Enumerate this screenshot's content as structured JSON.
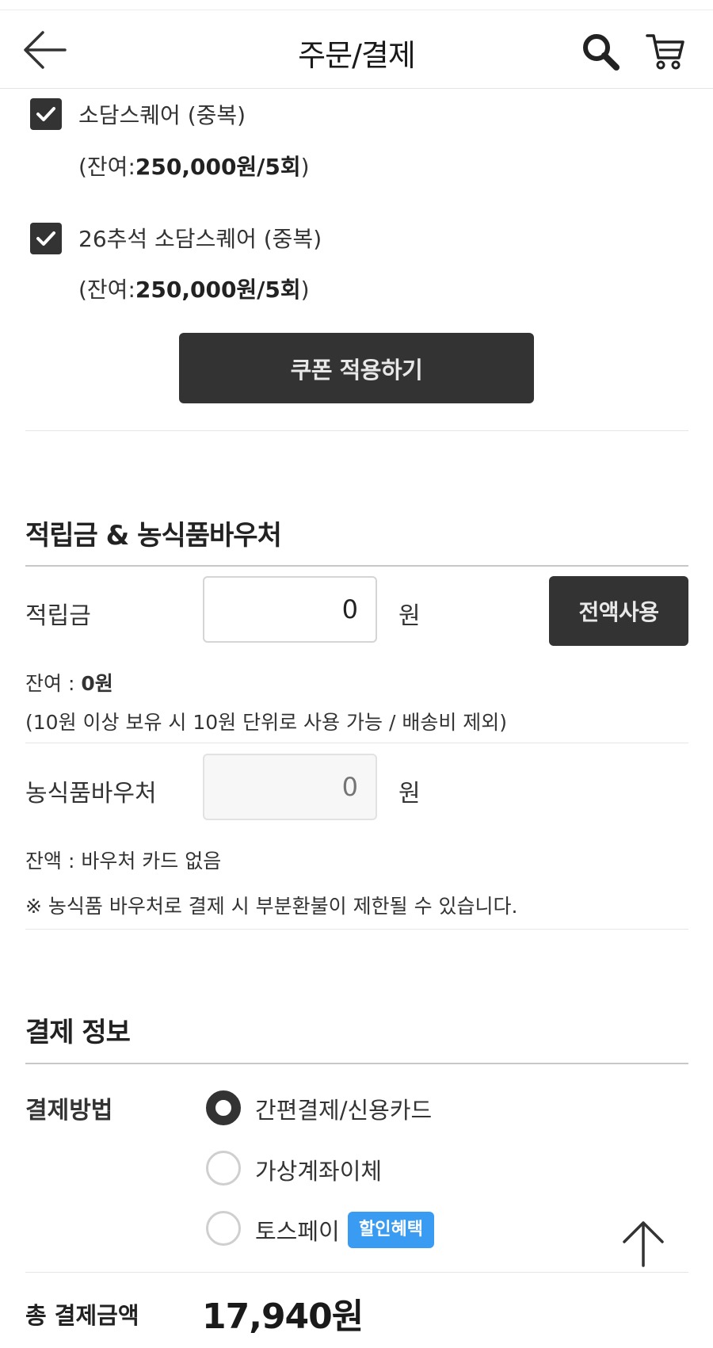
{
  "header": {
    "title": "주문/결제",
    "back_icon": "arrow-left-icon",
    "search_icon": "search-icon",
    "cart_icon": "cart-icon"
  },
  "coupons": [
    {
      "name": "소담스퀘어 (중복)",
      "balance_prefix": "(잔여:",
      "balance_value": "250,000원/5회",
      "balance_suffix": ")",
      "checked": true
    },
    {
      "name": "26추석 소담스퀘어 (중복)",
      "balance_prefix": "(잔여:",
      "balance_value": "250,000원/5회",
      "balance_suffix": ")",
      "checked": true
    }
  ],
  "apply_coupon_label": "쿠폰 적용하기",
  "points_section": {
    "title": "적립금 & 농식품바우처",
    "points_label": "적립금",
    "points_value": "0",
    "points_unit": "원",
    "use_all_label": "전액사용",
    "points_balance_prefix": "잔여 : ",
    "points_balance_value": "0원",
    "points_note": "(10원 이상 보유 시 10원 단위로 사용 가능 / 배송비 제외)",
    "voucher_label": "농식품바우처",
    "voucher_placeholder": "0",
    "voucher_unit": "원",
    "voucher_balance": "잔액 : 바우처 카드 없음",
    "voucher_note": "※ 농식품 바우처로 결제 시 부분환불이 제한될 수 있습니다."
  },
  "payment_section": {
    "title": "결제 정보",
    "method_label": "결제방법",
    "methods": [
      {
        "label": "간편결제/신용카드",
        "selected": true
      },
      {
        "label": "가상계좌이체",
        "selected": false
      },
      {
        "label": "토스페이",
        "selected": false
      }
    ],
    "promo_badge": "할인혜택",
    "total_label": "총 결제금액",
    "total_value": "17,940원"
  },
  "colors": {
    "dark_button": "#333333",
    "promo_blue": "#3a9bf2"
  }
}
